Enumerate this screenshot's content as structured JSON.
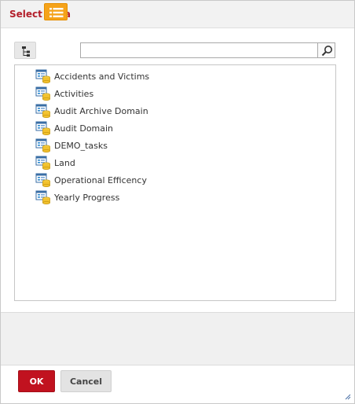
{
  "dialog": {
    "title": "Select Data"
  },
  "toolbar": {
    "tree_view_icon": "tree-view-icon",
    "list_view_icon": "list-view-icon",
    "search_value": "",
    "search_icon": "search-icon"
  },
  "data_sources": [
    {
      "label": "Accidents and Victims"
    },
    {
      "label": "Activities"
    },
    {
      "label": "Audit Archive Domain"
    },
    {
      "label": "Audit Domain"
    },
    {
      "label": "DEMO_tasks"
    },
    {
      "label": "Land"
    },
    {
      "label": "Operational Efficency"
    },
    {
      "label": "Yearly Progress"
    }
  ],
  "buttons": {
    "ok_label": "OK",
    "cancel_label": "Cancel"
  },
  "colors": {
    "title": "#b31f2b",
    "ok_button": "#c1121f",
    "list_view_active": "#f5a31a"
  }
}
